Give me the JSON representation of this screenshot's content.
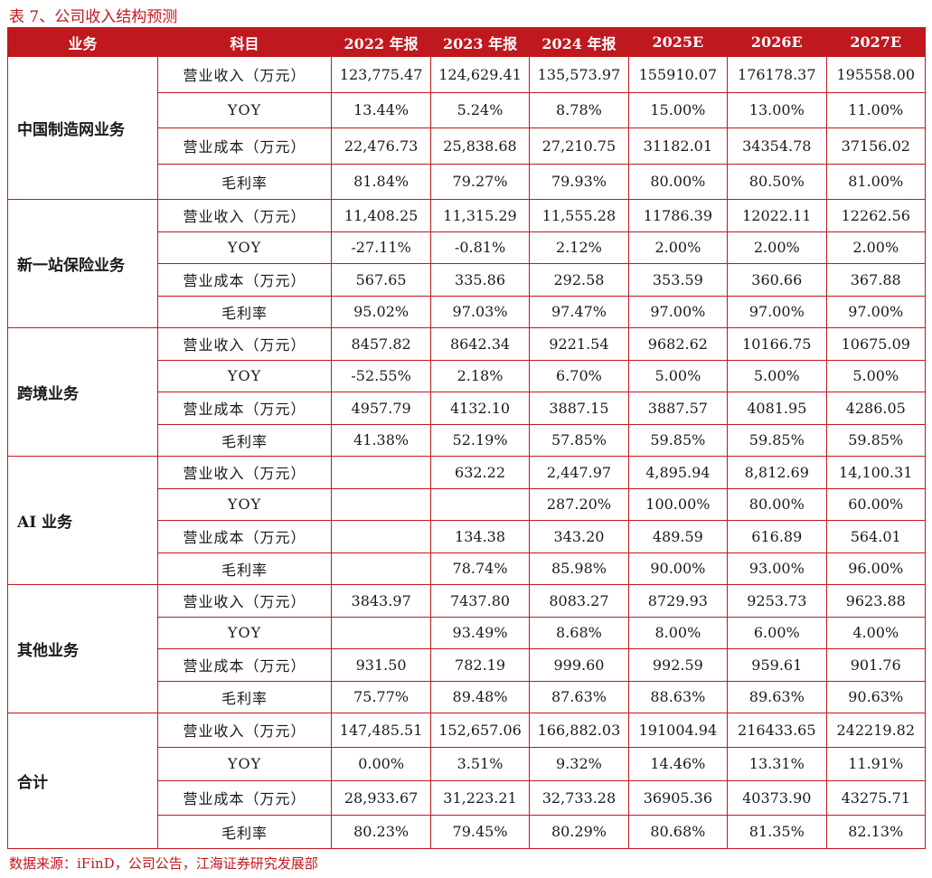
{
  "caption": "表 7、公司收入结构预测",
  "source": "数据来源：iFinD，公司公告，江海证券研究发展部",
  "colors": {
    "accent": "#c0181f"
  },
  "headers": [
    "业务",
    "科目",
    "2022 年报",
    "2023 年报",
    "2024 年报",
    "2025E",
    "2026E",
    "2027E"
  ],
  "segments": [
    {
      "name": "中国制造网业务",
      "rows": [
        {
          "item": "营业收入（万元）",
          "values": [
            "123,775.47",
            "124,629.41",
            "135,573.97",
            "155910.07",
            "176178.37",
            "195558.00"
          ]
        },
        {
          "item": "YOY",
          "values": [
            "13.44%",
            "5.24%",
            "8.78%",
            "15.00%",
            "13.00%",
            "11.00%"
          ]
        },
        {
          "item": "营业成本（万元）",
          "values": [
            "22,476.73",
            "25,838.68",
            "27,210.75",
            "31182.01",
            "34354.78",
            "37156.02"
          ]
        },
        {
          "item": "毛利率",
          "values": [
            "81.84%",
            "79.27%",
            "79.93%",
            "80.00%",
            "80.50%",
            "81.00%"
          ]
        }
      ]
    },
    {
      "name": "新一站保险业务",
      "rows": [
        {
          "item": "营业收入（万元）",
          "values": [
            "11,408.25",
            "11,315.29",
            "11,555.28",
            "11786.39",
            "12022.11",
            "12262.56"
          ]
        },
        {
          "item": "YOY",
          "values": [
            "-27.11%",
            "-0.81%",
            "2.12%",
            "2.00%",
            "2.00%",
            "2.00%"
          ]
        },
        {
          "item": "营业成本（万元）",
          "values": [
            "567.65",
            "335.86",
            "292.58",
            "353.59",
            "360.66",
            "367.88"
          ]
        },
        {
          "item": "毛利率",
          "values": [
            "95.02%",
            "97.03%",
            "97.47%",
            "97.00%",
            "97.00%",
            "97.00%"
          ]
        }
      ]
    },
    {
      "name": "跨境业务",
      "rows": [
        {
          "item": "营业收入（万元）",
          "values": [
            "8457.82",
            "8642.34",
            "9221.54",
            "9682.62",
            "10166.75",
            "10675.09"
          ]
        },
        {
          "item": "YOY",
          "values": [
            "-52.55%",
            "2.18%",
            "6.70%",
            "5.00%",
            "5.00%",
            "5.00%"
          ]
        },
        {
          "item": "营业成本（万元）",
          "values": [
            "4957.79",
            "4132.10",
            "3887.15",
            "3887.57",
            "4081.95",
            "4286.05"
          ]
        },
        {
          "item": "毛利率",
          "values": [
            "41.38%",
            "52.19%",
            "57.85%",
            "59.85%",
            "59.85%",
            "59.85%"
          ]
        }
      ]
    },
    {
      "name": "AI 业务",
      "rows": [
        {
          "item": "营业收入（万元）",
          "values": [
            "",
            "632.22",
            "2,447.97",
            "4,895.94",
            "8,812.69",
            "14,100.31"
          ]
        },
        {
          "item": "YOY",
          "values": [
            "",
            "",
            "287.20%",
            "100.00%",
            "80.00%",
            "60.00%"
          ]
        },
        {
          "item": "营业成本（万元）",
          "values": [
            "",
            "134.38",
            "343.20",
            "489.59",
            "616.89",
            "564.01"
          ]
        },
        {
          "item": "毛利率",
          "values": [
            "",
            "78.74%",
            "85.98%",
            "90.00%",
            "93.00%",
            "96.00%"
          ]
        }
      ]
    },
    {
      "name": "其他业务",
      "rows": [
        {
          "item": "营业收入（万元）",
          "values": [
            "3843.97",
            "7437.80",
            "8083.27",
            "8729.93",
            "9253.73",
            "9623.88"
          ]
        },
        {
          "item": "YOY",
          "values": [
            "",
            "93.49%",
            "8.68%",
            "8.00%",
            "6.00%",
            "4.00%"
          ]
        },
        {
          "item": "营业成本（万元）",
          "values": [
            "931.50",
            "782.19",
            "999.60",
            "992.59",
            "959.61",
            "901.76"
          ]
        },
        {
          "item": "毛利率",
          "values": [
            "75.77%",
            "89.48%",
            "87.63%",
            "88.63%",
            "89.63%",
            "90.63%"
          ]
        }
      ]
    },
    {
      "name": "合计",
      "rows": [
        {
          "item": "营业收入（万元）",
          "values": [
            "147,485.51",
            "152,657.06",
            "166,882.03",
            "191004.94",
            "216433.65",
            "242219.82"
          ]
        },
        {
          "item": "YOY",
          "values": [
            "0.00%",
            "3.51%",
            "9.32%",
            "14.46%",
            "13.31%",
            "11.91%"
          ]
        },
        {
          "item": "营业成本（万元）",
          "values": [
            "28,933.67",
            "31,223.21",
            "32,733.28",
            "36905.36",
            "40373.90",
            "43275.71"
          ]
        },
        {
          "item": "毛利率",
          "values": [
            "80.23%",
            "79.45%",
            "80.29%",
            "80.68%",
            "81.35%",
            "82.13%"
          ]
        }
      ]
    }
  ]
}
